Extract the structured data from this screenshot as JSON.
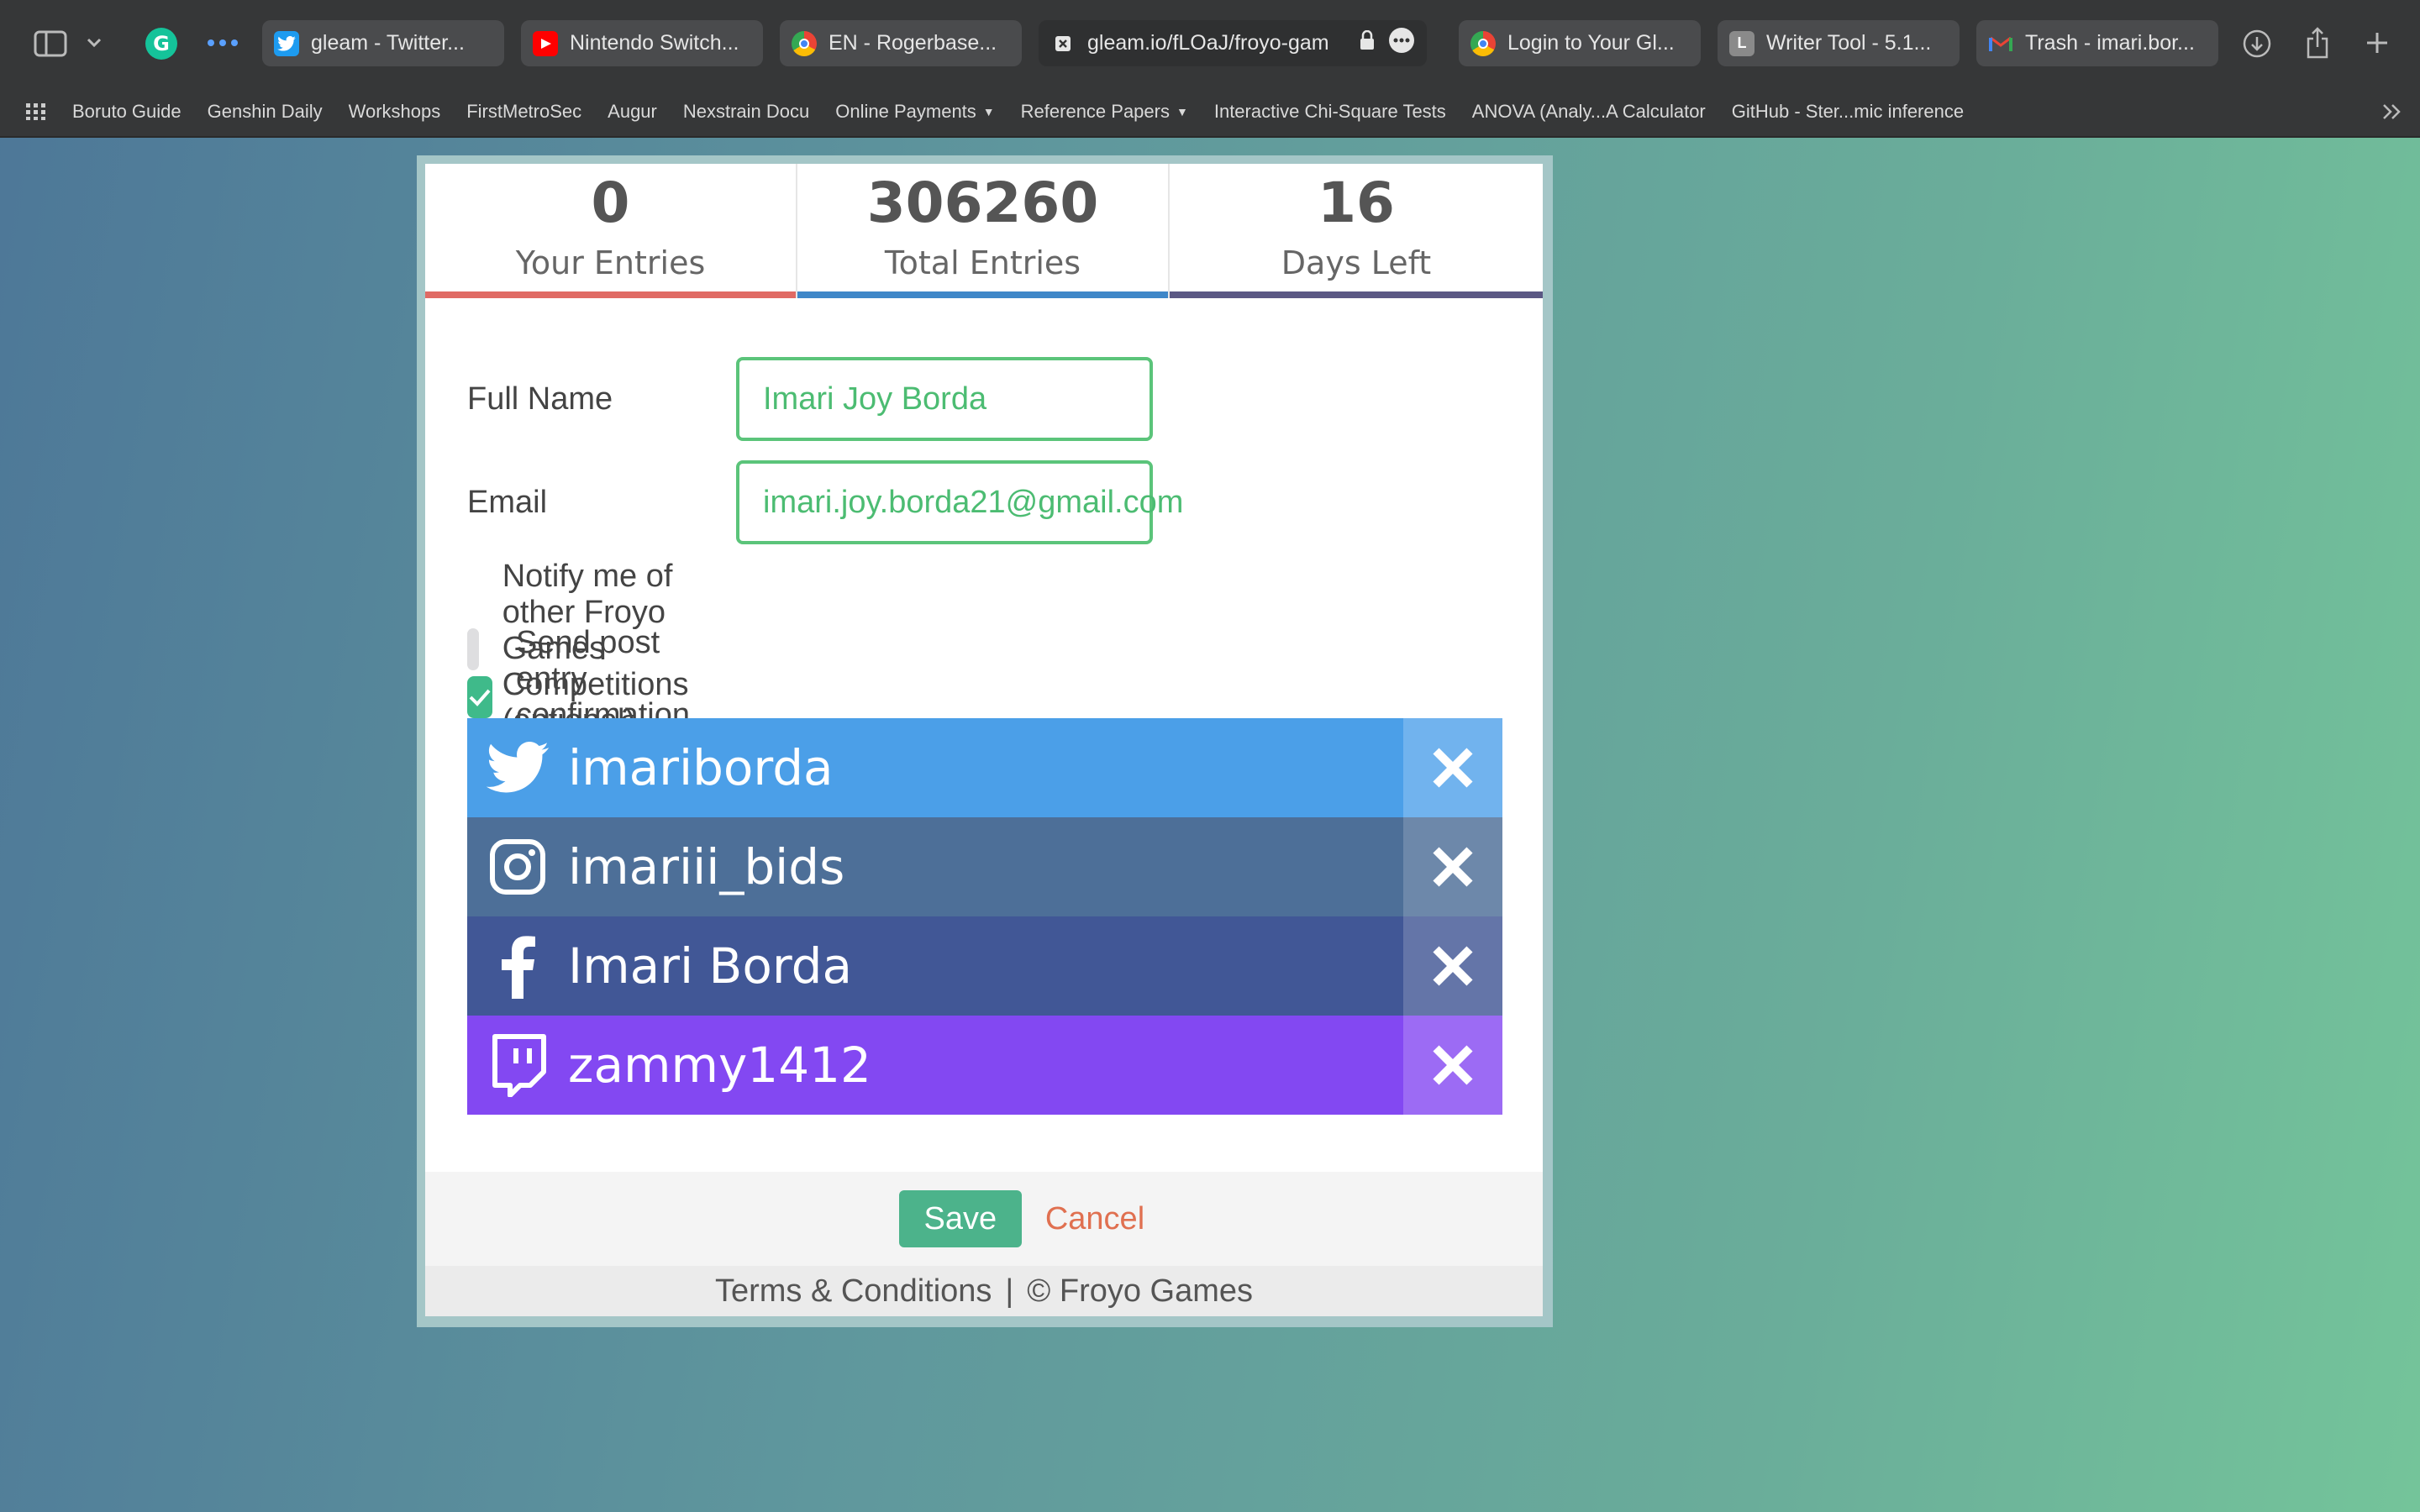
{
  "browser": {
    "tabs": [
      {
        "label": "gleam - Twitter...",
        "favicon": "twitter-icon",
        "color": "#1da1f2"
      },
      {
        "label": "Nintendo Switch...",
        "favicon": "youtube-icon",
        "color": "#ff0000"
      },
      {
        "label": "EN - Rogerbase...",
        "favicon": "chrome-icon",
        "color": "#f4b400"
      },
      {
        "label": "gleam.io/fLOaJ/froyo-gam",
        "favicon": "x-icon",
        "color": "#333333"
      },
      {
        "label": "Login to Your Gl...",
        "favicon": "chrome-icon",
        "color": "#f4b400"
      },
      {
        "label": "Writer Tool - 5.1...",
        "favicon": "L",
        "color": "#888888"
      },
      {
        "label": "Trash - imari.bor...",
        "favicon": "gmail-icon",
        "color": "#d93025"
      }
    ],
    "bookmarks": [
      {
        "label": "Boruto Guide"
      },
      {
        "label": "Genshin Daily"
      },
      {
        "label": "Workshops"
      },
      {
        "label": "FirstMetroSec"
      },
      {
        "label": "Augur"
      },
      {
        "label": "Nexstrain Docu"
      },
      {
        "label": "Online Payments",
        "dropdown": true
      },
      {
        "label": "Reference Papers",
        "dropdown": true
      },
      {
        "label": "Interactive Chi-Square Tests"
      },
      {
        "label": "ANOVA (Analy...A Calculator"
      },
      {
        "label": "GitHub - Ster...mic inference"
      }
    ]
  },
  "stats": [
    {
      "value": "0",
      "label": "Your Entries",
      "color": "#e06a64"
    },
    {
      "value": "306260",
      "label": "Total Entries",
      "color": "#3f87c8"
    },
    {
      "value": "16",
      "label": "Days Left",
      "color": "#5b5884"
    }
  ],
  "form": {
    "full_name_label": "Full Name",
    "full_name_value": "Imari Joy Borda",
    "email_label": "Email",
    "email_value": "imari.joy.borda21@gmail.com",
    "notify_label": "Notify me of other Froyo Games Competitions (optional)",
    "notify_checked": false,
    "confirm_label": "Send post entry confirmation emails",
    "confirm_checked": true
  },
  "social_accounts": [
    {
      "network": "twitter",
      "handle": "imariborda",
      "color": "#4b9fe8",
      "x_color": "#71b3ee"
    },
    {
      "network": "instagram",
      "handle": "imariii_bids",
      "color": "#4d6f98",
      "x_color": "#6d88aa"
    },
    {
      "network": "facebook",
      "handle": "Imari Borda",
      "color": "#415796",
      "x_color": "#6475a8"
    },
    {
      "network": "twitch",
      "handle": "zammy1412",
      "color": "#8348f2",
      "x_color": "#9c6bf4"
    }
  ],
  "footer": {
    "save_label": "Save",
    "cancel_label": "Cancel",
    "terms_label": "Terms & Conditions",
    "separator": "|",
    "copyright_label": "© Froyo Games"
  }
}
